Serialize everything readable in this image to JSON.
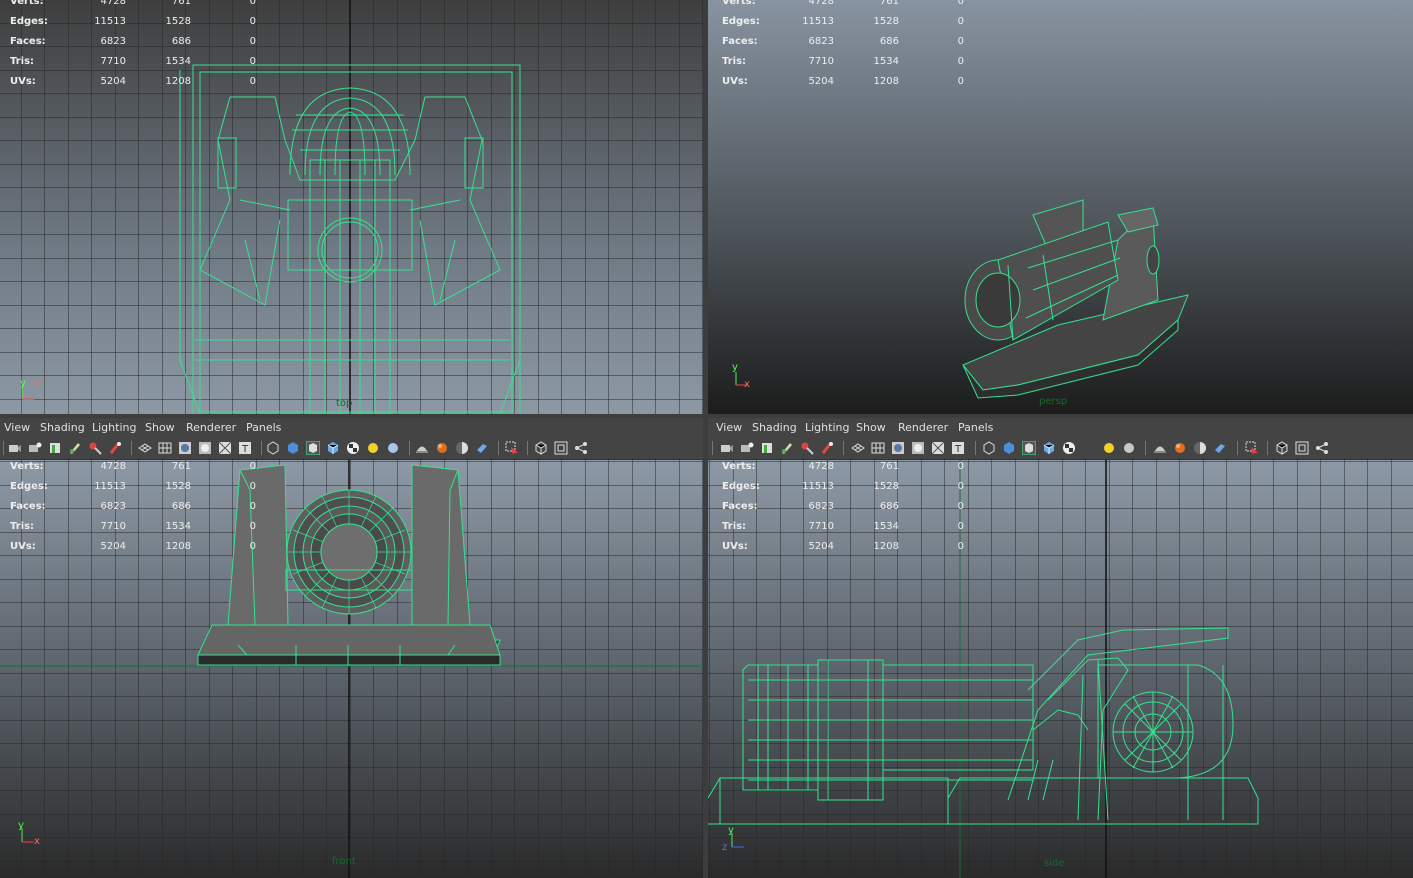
{
  "menu": {
    "view": "View",
    "shading": "Shading",
    "lighting": "Lighting",
    "show": "Show",
    "renderer": "Renderer",
    "panels": "Panels"
  },
  "hud": {
    "labels": {
      "verts": "Verts:",
      "edges": "Edges:",
      "faces": "Faces:",
      "tris": "Tris:",
      "uvs": "UVs:"
    },
    "verts": [
      4728,
      761,
      0
    ],
    "edges": [
      11513,
      1528,
      0
    ],
    "faces": [
      6823,
      686,
      0
    ],
    "tris": [
      7710,
      1534,
      0
    ],
    "uvs": [
      5204,
      1208,
      0
    ]
  },
  "cameras": {
    "top": "top",
    "persp": "persp",
    "front": "front",
    "side": "side"
  },
  "axis": {
    "x": "x",
    "y": "y",
    "z": "z"
  },
  "icons": [
    "camera-attributes-icon",
    "bookmark-icon",
    "image-plane-icon",
    "grease-pencil-icon",
    "2d-pan-zoom-icon",
    "render-icon",
    "wireframe-icon",
    "grid-icon",
    "smooth-shade-icon",
    "flat-shade-icon",
    "bounding-box-icon",
    "xray-icon",
    "texture-icon",
    "default-light-icon",
    "shadows-icon",
    "isolate-select-icon",
    "layout-single-icon",
    "layout-four-icon",
    "share-icon"
  ],
  "colors": {
    "wire": "#35e28e",
    "viewport_top": "#8c98a4",
    "viewport_bottom": "#2c2c2c",
    "panel": "#444444",
    "grid": "#2b2b2b"
  }
}
